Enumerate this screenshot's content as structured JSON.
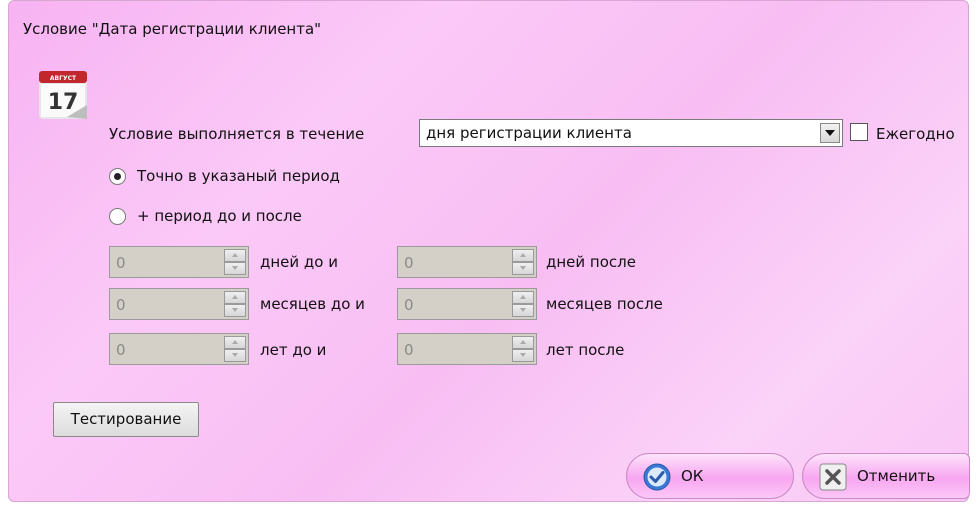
{
  "dialog": {
    "title": "Условие \"Дата регистрации клиента\"",
    "calendar_month": "АВГУСТ",
    "calendar_day": "17"
  },
  "condition": {
    "label": "Условие выполняется в течение",
    "combo_value": "дня регистрации клиента",
    "yearly_label": "Ежегодно",
    "yearly_checked": false
  },
  "period": {
    "exact_label": "Точно в указаный период",
    "exact_selected": true,
    "plus_label": "+ период до и после",
    "plus_selected": false
  },
  "rows": [
    {
      "before_value": "0",
      "before_label": "дней до и",
      "after_value": "0",
      "after_label": "дней после"
    },
    {
      "before_value": "0",
      "before_label": "месяцев до и",
      "after_value": "0",
      "after_label": "месяцев после"
    },
    {
      "before_value": "0",
      "before_label": "лет до и",
      "after_value": "0",
      "after_label": "лет после"
    }
  ],
  "buttons": {
    "test": "Тестирование",
    "ok": "ОК",
    "cancel": "Отменить"
  },
  "colors": {
    "background": "#f8bef3",
    "ok_icon": "#3a78d6"
  },
  "icons": {
    "calendar": "calendar-icon",
    "ok": "checkmark-icon",
    "cancel": "cross-icon"
  }
}
